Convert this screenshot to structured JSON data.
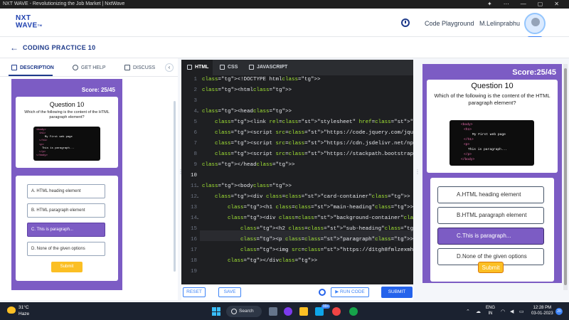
{
  "window": {
    "title": "NXT WAVE - Revolutionizing the Job Market | NxtWave"
  },
  "header": {
    "logo_line1": "NXT",
    "logo_line2": "WAVE",
    "logo_tm": "TM",
    "code_playground": "Code Playground",
    "user_name": "M.Lelinprabhu",
    "badge": "SMART"
  },
  "page": {
    "back": "←",
    "title": "CODING PRACTICE 10"
  },
  "left_tabs": {
    "description": "DESCRIPTION",
    "get_help": "GET HELP",
    "discuss": "DISCUSS",
    "collapse": "‹"
  },
  "small_preview": {
    "score": "Score: 25/45",
    "question_title": "Question 10",
    "question_text": "Which of the following is the content of the HTML paragraph element?",
    "options": [
      "A. HTML heading element",
      "B. HTML paragraph element",
      "C. This is paragraph...",
      "D. None of the given options"
    ],
    "submit": "Submit"
  },
  "code_image": {
    "lines": [
      "<body>",
      "<h1>",
      "My First web page",
      "</h1>",
      "<p>",
      "This is paragraph...",
      "</p>",
      "</body>"
    ]
  },
  "editor": {
    "tabs": [
      "HTML",
      "CSS",
      "JAVASCRIPT"
    ],
    "line_numbers": [
      "1",
      "2",
      "3",
      "4",
      "5",
      "6",
      "7",
      "8",
      "9",
      "10",
      "11",
      "12",
      "13",
      "14",
      "15",
      "16",
      "17",
      "18",
      "19"
    ],
    "lines": [
      "<!DOCTYPE html>",
      "<html>",
      "",
      "<head>",
      "    <link rel=\"stylesheet\" href=\"https://stackpath.bootstrapcdn",
      "    <script src=\"https://code.jquery.com/jquery-3.5.1.slim.min.",
      "    <script src=\"https://cdn.jsdelivr.net/npm/popper.js@1.16.1/",
      "    <script src=\"https://stackpath.bootstrapcdn.com/bootstrap/4",
      "</head>",
      "",
      "<body>",
      "    <div class=\"card-container\">",
      "        <h1 class=\"main-heading\">Score:25/45</h1>",
      "        <div class=\"background-container\">",
      "            <h2 class=\"sub-heading\"> Question 10</h2>",
      "            <p class=\"paragraph\"> Which of the following is the",
      "            <img src=\"https://d1tgh8fmlzexmh.cloudfront.net/ccb",
      "        </div>",
      ""
    ]
  },
  "editor_bar": {
    "reset": "RESET",
    "save": "SAVE",
    "run_code": "▶ RUN CODE",
    "submit": "SUBMIT"
  },
  "large_preview": {
    "score": "Score:25/45",
    "question_title": "Question 10",
    "question_text": "Which of the following is the content of the HTML paragraph element?",
    "options": [
      "A.HTML heading element",
      "B.HTML paragraph element",
      "C.This is paragraph...",
      "D.None of the given options"
    ],
    "submit": "Submit"
  },
  "taskbar": {
    "temp": "31°C",
    "condition": "Haze",
    "search": "Search",
    "lang1": "ENG",
    "lang2": "IN",
    "time": "12:28 PM",
    "date": "03-01-2023",
    "badge": "99+",
    "notif": "20"
  },
  "colors": {
    "brand": "#1e3a8a",
    "purple": "#7c5cc4",
    "accent": "#2563eb",
    "submit": "#fbbf24"
  }
}
